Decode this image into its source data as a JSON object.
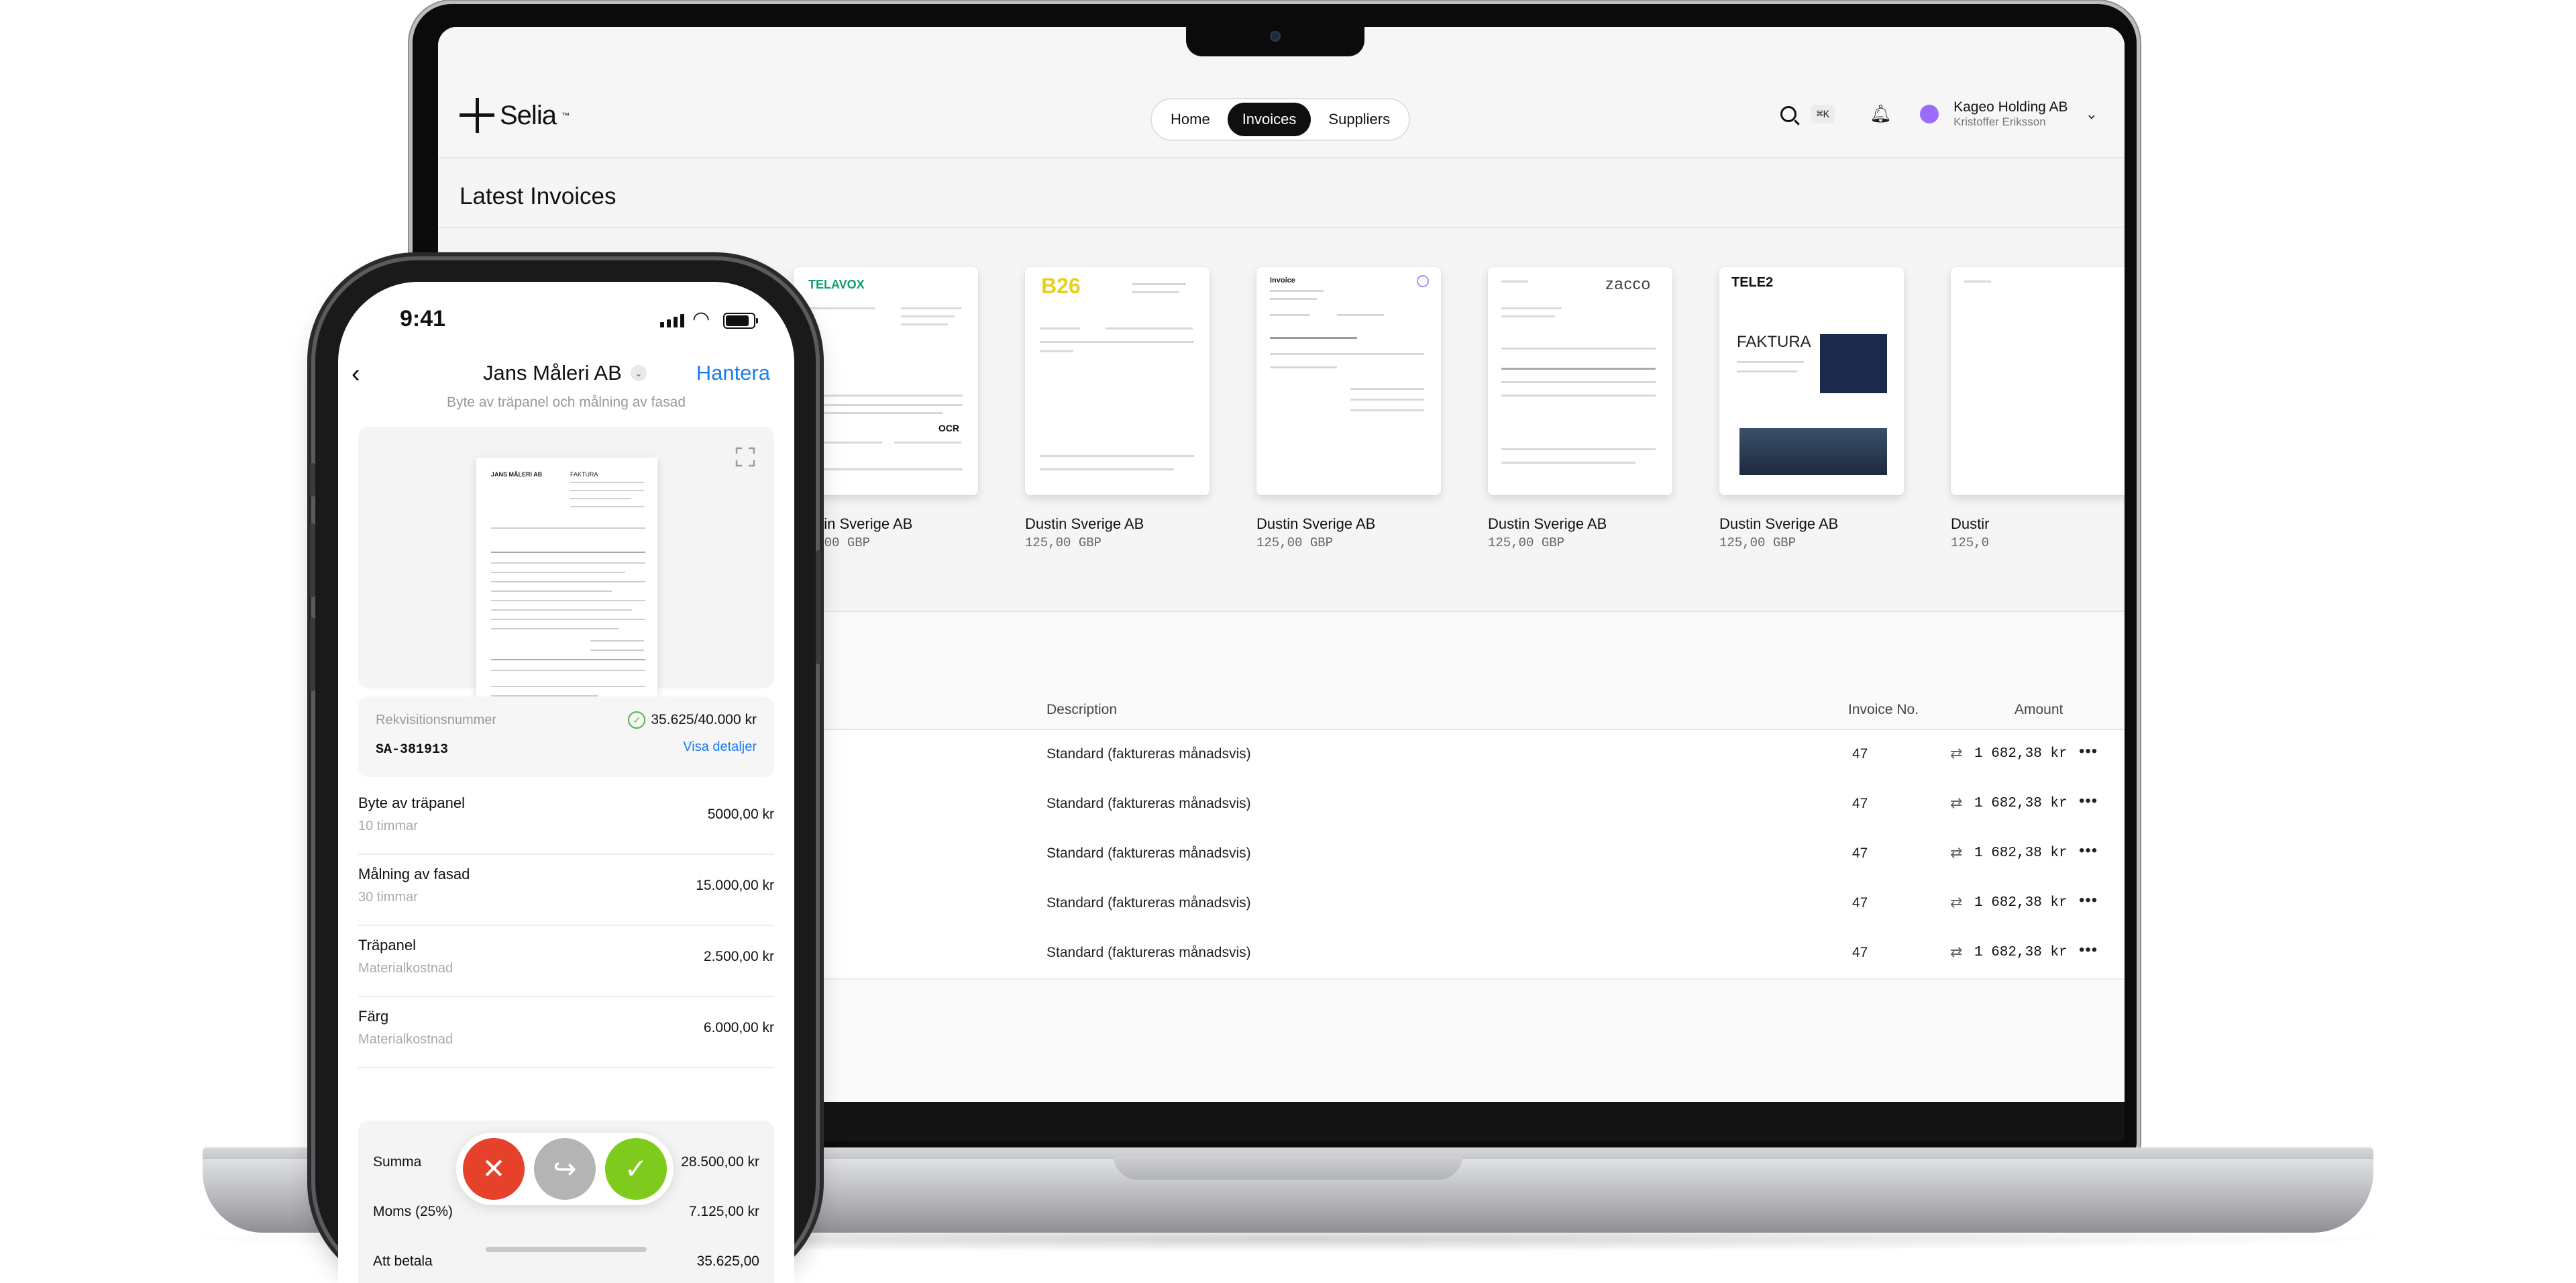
{
  "laptop": {
    "app": {
      "brand": "Selia",
      "brand_tm": "™",
      "nav": [
        "Home",
        "Invoices",
        "Suppliers"
      ],
      "nav_active": "Invoices",
      "search_shortcut": "⌘K",
      "account_name": "Kageo Holding AB",
      "account_user": "Kristoffer Eriksson",
      "avatar_color": "#9b6cff"
    },
    "latest_invoices": {
      "title": "Latest Invoices",
      "cards": [
        {
          "name": "Dustin Sverige AB",
          "amount": "125,00 GBP",
          "brand": "TELAVOX"
        },
        {
          "name": "Dustin Sverige AB",
          "amount": "125,00 GBP",
          "brand": "B26"
        },
        {
          "name": "Dustin Sverige AB",
          "amount": "125,00 GBP",
          "brand": "Invoice"
        },
        {
          "name": "Dustin Sverige AB",
          "amount": "125,00 GBP",
          "brand": "zacco"
        },
        {
          "name": "Dustin Sverige AB",
          "amount": "125,00 GBP",
          "brand": "TELE2",
          "doc_title": "FAKTURA"
        },
        {
          "name": "Dustir",
          "amount": "125,0",
          "brand": ""
        }
      ],
      "ocr_label": "OCR"
    },
    "table": {
      "headers": {
        "description": "Description",
        "invoice_no": "Invoice No.",
        "amount": "Amount"
      },
      "rows": [
        {
          "description": "Standard (faktureras månadsvis)",
          "invoice_no": "47",
          "amount": "1 682,38 kr"
        },
        {
          "description": "Standard (faktureras månadsvis)",
          "invoice_no": "47",
          "amount": "1 682,38 kr"
        },
        {
          "description": "Standard (faktureras månadsvis)",
          "invoice_no": "47",
          "amount": "1 682,38 kr"
        },
        {
          "description": "Standard (faktureras månadsvis)",
          "invoice_no": "47",
          "amount": "1 682,38 kr"
        },
        {
          "description": "Standard (faktureras månadsvis)",
          "invoice_no": "47",
          "amount": "1 682,38 kr"
        }
      ],
      "more_glyph": "•••"
    }
  },
  "phone": {
    "time": "9:41",
    "title": "Jans Måleri AB",
    "action": "Hantera",
    "subtitle": "Byte av träpanel och målning av fasad",
    "doc": {
      "company": "JANS MÅLERI AB",
      "doc_type": "FAKTURA"
    },
    "requisition": {
      "label": "Rekvisitionsnummer",
      "value": "SA-381913",
      "amount": "35.625/40.000 kr",
      "link": "Visa detaljer"
    },
    "items": [
      {
        "title": "Byte av träpanel",
        "sub": "10 timmar",
        "amount": "5000,00 kr"
      },
      {
        "title": "Målning av fasad",
        "sub": "30 timmar",
        "amount": "15.000,00 kr"
      },
      {
        "title": "Träpanel",
        "sub": "Materialkostnad",
        "amount": "2.500,00 kr"
      },
      {
        "title": "Färg",
        "sub": "Materialkostnad",
        "amount": "6.000,00 kr"
      }
    ],
    "summary": [
      {
        "label": "Summa",
        "value": "28.500,00 kr"
      },
      {
        "label": "Moms (25%)",
        "value": "7.125,00 kr"
      },
      {
        "label": "Att betala",
        "value": "35.625,00"
      }
    ],
    "actions": {
      "reject": "✕",
      "forward": "↪",
      "approve": "✓"
    },
    "colors": {
      "reject": "#e5412b",
      "forward": "#b4b4b4",
      "approve": "#7ecb1d",
      "link": "#1a7cf2"
    }
  }
}
